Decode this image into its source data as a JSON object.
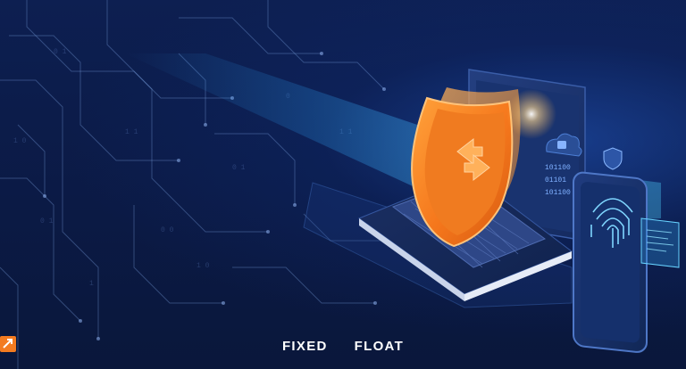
{
  "brand": {
    "word_left": "FIXED",
    "word_right": "FLOAT",
    "mark_icon": "fixedfloat-arrows-icon"
  },
  "screen": {
    "binary_line_1": "101100",
    "binary_line_2": "01101",
    "binary_line_3": "101100"
  },
  "colors": {
    "background": "#0b1a43",
    "accent_orange": "#f37b20",
    "accent_cyan": "#35d2ff"
  },
  "icons": [
    "shield-icon",
    "laptop-icon",
    "phone-icon",
    "fingerprint-icon",
    "cloud-lock-icon"
  ]
}
